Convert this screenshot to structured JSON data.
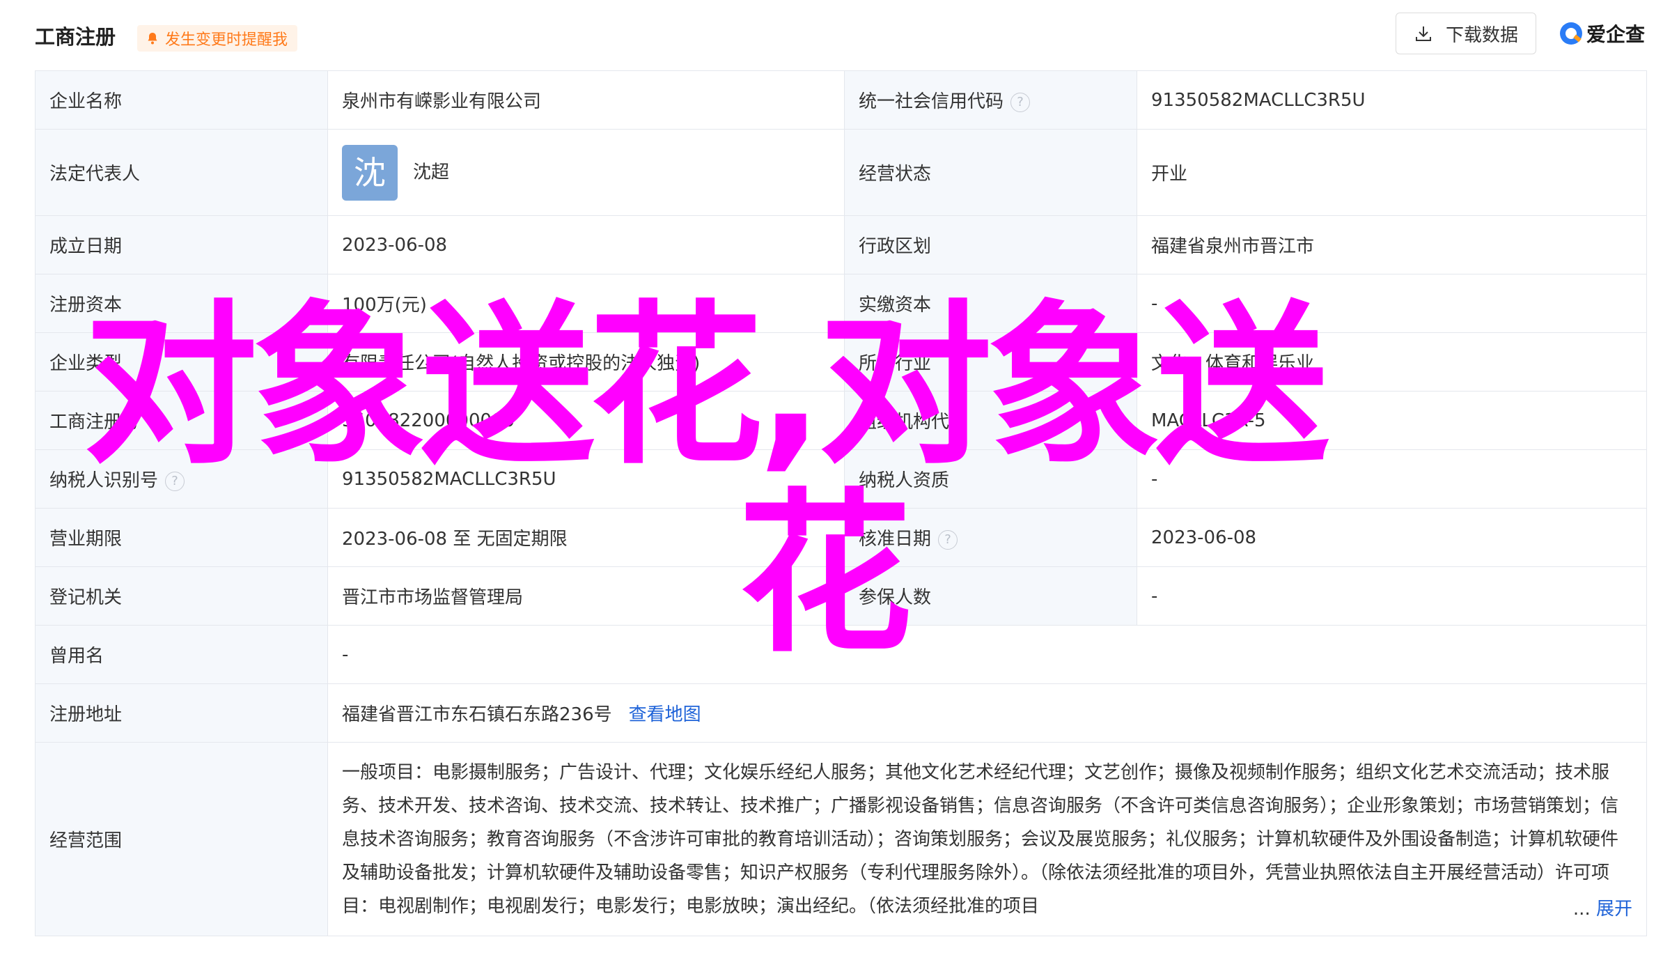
{
  "header": {
    "title": "工商注册",
    "alert_label": "发生变更时提醒我",
    "download_label": "下载数据",
    "logo_text": "爱企查"
  },
  "rows": {
    "company_name": {
      "label": "企业名称",
      "value": "泉州市有嵘影业有限公司"
    },
    "credit_code": {
      "label": "统一社会信用代码",
      "value": "91350582MACLLC3R5U"
    },
    "legal_rep": {
      "label": "法定代表人",
      "avatar_char": "沈",
      "value": "沈超"
    },
    "status": {
      "label": "经营状态",
      "value": "开业"
    },
    "founded": {
      "label": "成立日期",
      "value": "2023-06-08"
    },
    "region": {
      "label": "行政区划",
      "value": "福建省泉州市晋江市"
    },
    "reg_capital": {
      "label": "注册资本",
      "value": "100万(元)"
    },
    "paid_capital": {
      "label": "实缴资本",
      "value": "-"
    },
    "company_type": {
      "label": "企业类型",
      "value": "有限责任公司(自然人投资或控股的法人独资)"
    },
    "industry": {
      "label": "所属行业",
      "value": "文化、体育和娱乐业"
    },
    "reg_number": {
      "label": "工商注册号",
      "value": "350582200000000"
    },
    "org_code": {
      "label": "组织机构代码",
      "value": "MACLLC3R-5"
    },
    "taxpayer_id": {
      "label": "纳税人识别号",
      "value": "91350582MACLLC3R5U"
    },
    "taxpayer_qual": {
      "label": "纳税人资质",
      "value": "-"
    },
    "term": {
      "label": "营业期限",
      "value": "2023-06-08 至 无固定期限"
    },
    "approval_date": {
      "label": "核准日期",
      "value": "2023-06-08"
    },
    "authority": {
      "label": "登记机关",
      "value": "晋江市市场监督管理局"
    },
    "insured": {
      "label": "参保人数",
      "value": "-"
    },
    "former_name": {
      "label": "曾用名",
      "value": "-"
    },
    "address": {
      "label": "注册地址",
      "value": "福建省晋江市东石镇石东路236号",
      "link": "查看地图"
    },
    "scope": {
      "label": "经营范围",
      "value": "一般项目：电影摄制服务；广告设计、代理；文化娱乐经纪人服务；其他文化艺术经纪代理；文艺创作；摄像及视频制作服务；组织文化艺术交流活动；技术服务、技术开发、技术咨询、技术交流、技术转让、技术推广；广播影视设备销售；信息咨询服务（不含许可类信息咨询服务）；企业形象策划；市场营销策划；信息技术咨询服务；教育咨询服务（不含涉许可审批的教育培训活动）；咨询策划服务；会议及展览服务；礼仪服务；计算机软硬件及外围设备制造；计算机软硬件及辅助设备批发；计算机软硬件及辅助设备零售；知识产权服务（专利代理服务除外）。（除依法须经批准的项目外，凭营业执照依法自主开展经营活动）许可项目：电视剧制作；电视剧发行；电影发行；电影放映；演出经纪。（依法须经批准的项目",
      "ellipsis": "...",
      "expand": "展开"
    }
  },
  "watermark": {
    "line1": "对象送花,对象送",
    "line2": "花",
    "color": "#ff00ff"
  }
}
